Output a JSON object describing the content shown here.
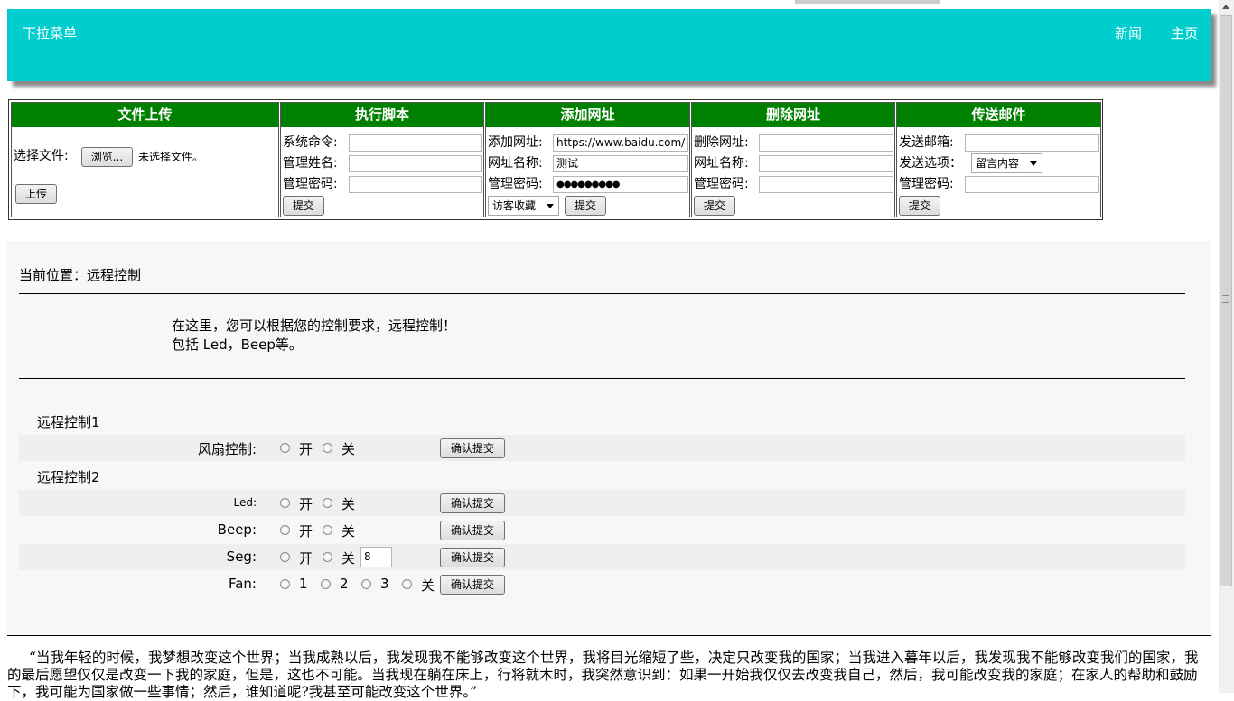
{
  "header": {
    "brand": "下拉菜单",
    "nav": [
      "新闻",
      "主页"
    ]
  },
  "panels": {
    "upload": {
      "title": "文件上传",
      "choose_label": "选择文件:",
      "browse": "浏览...",
      "no_file": "未选择文件。",
      "upload_btn": "上传"
    },
    "script": {
      "title": "执行脚本",
      "cmd_label": "系统命令:",
      "name_label": "管理姓名:",
      "pwd_label": "管理密码:",
      "submit": "提交"
    },
    "addurl": {
      "title": "添加网址",
      "url_label": "添加网址:",
      "url_value": "https://www.baidu.com/",
      "name_label": "网址名称:",
      "name_value": "测试",
      "pwd_label": "管理密码:",
      "pwd_value": "●●●●●●●●●",
      "select_value": "访客收藏",
      "submit": "提交"
    },
    "delurl": {
      "title": "删除网址",
      "url_label": "删除网址:",
      "name_label": "网址名称:",
      "pwd_label": "管理密码:",
      "submit": "提交"
    },
    "mail": {
      "title": "传送邮件",
      "mail_label": "发送邮箱:",
      "option_label": "发送选项：",
      "select_value": "留言内容",
      "pwd_label": "管理密码:",
      "submit": "提交"
    }
  },
  "main": {
    "location": "当前位置：远程控制",
    "intro1": "在这里，您可以根据您的控制要求，远程控制！",
    "intro2": "包括 Led，Beep等。",
    "group1": "远程控制1",
    "group2": "远程控制2",
    "confirm": "确认提交",
    "on": "开",
    "off": "关",
    "fan_control": "风扇控制:",
    "led": "Led:",
    "beep": "Beep:",
    "seg": "Seg:",
    "seg_value": "8",
    "fan": "Fan:",
    "fan_opts": [
      "1",
      "2",
      "3",
      "关"
    ]
  },
  "quote": "“当我年轻的时候，我梦想改变这个世界；当我成熟以后，我发现我不能够改变这个世界，我将目光缩短了些，决定只改变我的国家；当我进入暮年以后，我发现我不能够改变我们的国家，我的最后愿望仅仅是改变一下我的家庭，但是，这也不可能。当我现在躺在床上，行将就木时，我突然意识到：如果一开始我仅仅去改变我自己，然后，我可能改变我的家庭；在家人的帮助和鼓励下，我可能为国家做一些事情；然后，谁知道呢?我甚至可能改变这个世界。”"
}
